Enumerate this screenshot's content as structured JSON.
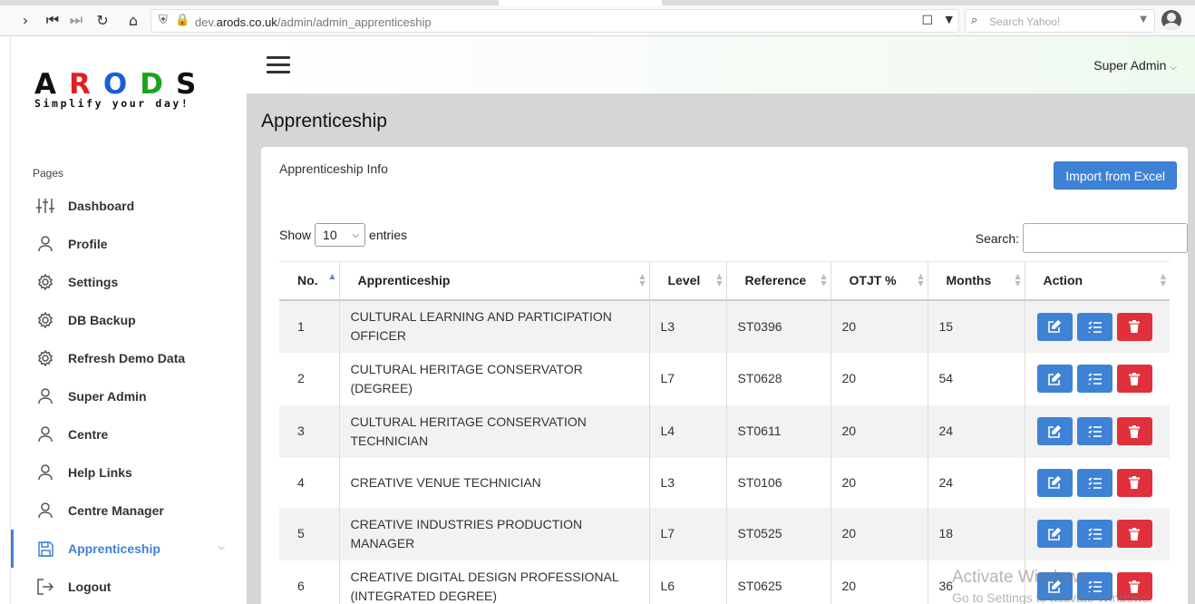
{
  "browser": {
    "url_prefix": "dev.",
    "url_domain": "arods.co.uk",
    "url_path": "/admin/admin_apprenticeship",
    "search_placeholder": "Search Yahoo!"
  },
  "logo": {
    "letters": [
      "A",
      "R",
      "O",
      "D",
      "S"
    ],
    "tagline": "Simplify your day!"
  },
  "sidebar": {
    "section_label": "Pages",
    "items": [
      {
        "label": "Dashboard",
        "icon": "sliders-icon"
      },
      {
        "label": "Profile",
        "icon": "user-icon"
      },
      {
        "label": "Settings",
        "icon": "gear-icon"
      },
      {
        "label": "DB Backup",
        "icon": "gear-icon"
      },
      {
        "label": "Refresh Demo Data",
        "icon": "gear-icon"
      },
      {
        "label": "Super Admin",
        "icon": "user-icon"
      },
      {
        "label": "Centre",
        "icon": "user-icon"
      },
      {
        "label": "Help Links",
        "icon": "user-icon"
      },
      {
        "label": "Centre Manager",
        "icon": "user-icon"
      },
      {
        "label": "Apprenticeship",
        "icon": "save-icon",
        "active": true
      },
      {
        "label": "Logout",
        "icon": "logout-icon"
      }
    ]
  },
  "header": {
    "user_label": "Super Admin"
  },
  "main": {
    "page_title": "Apprenticeship",
    "card_title": "Apprenticeship Info",
    "import_button": "Import from Excel",
    "show_label": "Show",
    "entries_value": "10",
    "entries_label": "entries",
    "search_label": "Search:"
  },
  "table": {
    "columns": [
      "No.",
      "Apprenticeship",
      "Level",
      "Reference",
      "OTJT %",
      "Months",
      "Action"
    ],
    "rows": [
      {
        "no": "1",
        "name_l1": "CULTURAL LEARNING AND PARTICIPATION",
        "name_l2": "OFFICER",
        "level": "L3",
        "reference": "ST0396",
        "otjt": "20",
        "months": "15"
      },
      {
        "no": "2",
        "name_l1": "CULTURAL HERITAGE CONSERVATOR",
        "name_l2": "(DEGREE)",
        "level": "L7",
        "reference": "ST0628",
        "otjt": "20",
        "months": "54"
      },
      {
        "no": "3",
        "name_l1": "CULTURAL HERITAGE CONSERVATION",
        "name_l2": "TECHNICIAN",
        "level": "L4",
        "reference": "ST0611",
        "otjt": "20",
        "months": "24"
      },
      {
        "no": "4",
        "name_l1": "CREATIVE VENUE TECHNICIAN",
        "name_l2": "",
        "level": "L3",
        "reference": "ST0106",
        "otjt": "20",
        "months": "24"
      },
      {
        "no": "5",
        "name_l1": "CREATIVE INDUSTRIES PRODUCTION",
        "name_l2": "MANAGER",
        "level": "L7",
        "reference": "ST0525",
        "otjt": "20",
        "months": "18"
      },
      {
        "no": "6",
        "name_l1": "CREATIVE DIGITAL DESIGN PROFESSIONAL",
        "name_l2": "(INTEGRATED DEGREE)",
        "level": "L6",
        "reference": "ST0625",
        "otjt": "20",
        "months": "36"
      }
    ]
  },
  "watermark": {
    "line1": "Activate Windows",
    "line2": "Go to Settings to activate Windows."
  },
  "colors": {
    "accent": "#3e82d6",
    "danger": "#e0303c"
  }
}
